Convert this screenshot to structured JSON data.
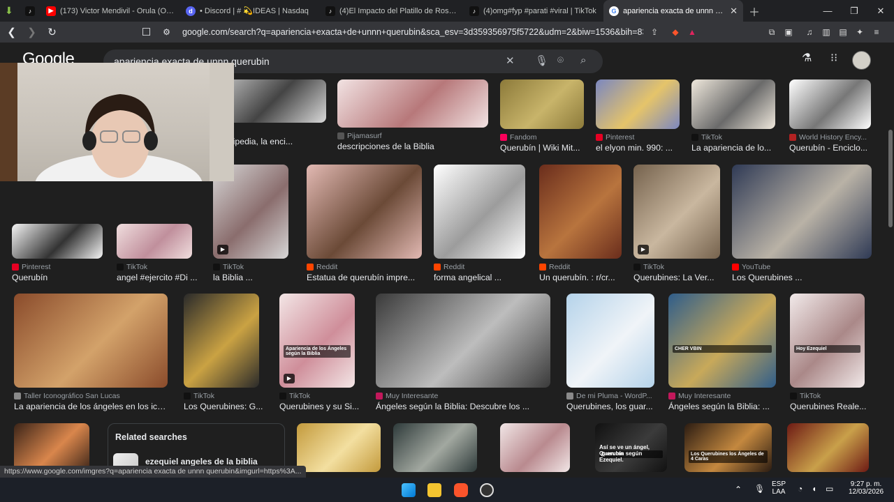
{
  "browser": {
    "tabs": [
      {
        "title": "(173) Victor Mendivil - Orula (Oficial)",
        "icon": "youtube-icon",
        "color": "#ff0000"
      },
      {
        "title": "• Discord | # 💫IDEAS | Nasdaq",
        "icon": "discord-icon",
        "color": "#5865f2"
      },
      {
        "title": "(4)El Impacto del Platillo de Roswell e",
        "icon": "tiktok-icon",
        "color": "#111111"
      },
      {
        "title": "(4)omg#fyp #parati #viral | TikTok",
        "icon": "tiktok-icon",
        "color": "#111111"
      },
      {
        "title": "apariencia exacta de unnn querubin",
        "icon": "google-icon",
        "color": "#4285f4",
        "active": true
      }
    ],
    "url": "google.com/search?q=apariencia+exacta+de+unnn+querubin&sca_esv=3d359356975f5722&udm=2&biw=1536&bih=831&s..."
  },
  "google": {
    "logo": "Google",
    "query": "apariencia exacta de unnn querubin"
  },
  "results": [
    {
      "id": "r0a",
      "source": "",
      "title": "",
      "colors": [
        "#e8d7d5",
        "#b88a86"
      ]
    },
    {
      "id": "r0b",
      "source": "",
      "title": "",
      "colors": [
        "#efe2e2",
        "#c49a9a"
      ]
    },
    {
      "id": "r0c",
      "source": "pedia",
      "title": "ín - Wikipedia, la enci...",
      "colors": [
        "#d9d9d9",
        "#444444"
      ]
    },
    {
      "id": "r0d",
      "source": "Pijamasurf",
      "title": "descripciones de la Biblia",
      "colors": [
        "#f2e3e3",
        "#b7787a"
      ]
    },
    {
      "id": "r0e",
      "source": "Fandom",
      "title": "Querubín | Wiki Mit...",
      "colors": [
        "#8c7a3a",
        "#c8b46a"
      ]
    },
    {
      "id": "r0f",
      "source": "Pinterest",
      "title": "el elyon min. 990: ...",
      "colors": [
        "#7b87c0",
        "#e5c46a"
      ]
    },
    {
      "id": "r0g",
      "source": "TikTok",
      "title": "La apariencia de lo...",
      "colors": [
        "#efe8dc",
        "#6a6a6a"
      ]
    },
    {
      "id": "r0h",
      "source": "World History Ency...",
      "title": "Querubín - Enciclo...",
      "colors": [
        "#ffffff",
        "#777777"
      ]
    },
    {
      "id": "r1a",
      "source": "Pinterest",
      "title": "Querubín",
      "colors": [
        "#f5f5f5",
        "#333333"
      ]
    },
    {
      "id": "r1b",
      "source": "TikTok",
      "title": "angel #ejercito #Di ...",
      "colors": [
        "#f0dede",
        "#c08f9c"
      ]
    },
    {
      "id": "r1c",
      "source": "TikTok",
      "title": "la Biblia ...",
      "colors": [
        "#d7d7d7",
        "#8a6d6d"
      ]
    },
    {
      "id": "r1d",
      "source": "Reddit",
      "title": "Estatua de querubín impre...",
      "colors": [
        "#e2b9b3",
        "#6b4a37"
      ]
    },
    {
      "id": "r1e",
      "source": "Reddit",
      "title": "forma angelical ...",
      "colors": [
        "#ffffff",
        "#9c9c9c"
      ]
    },
    {
      "id": "r1f",
      "source": "Reddit",
      "title": "Un querubín. : r/cr...",
      "colors": [
        "#6a2d1c",
        "#b8743e"
      ]
    },
    {
      "id": "r1g",
      "source": "TikTok",
      "title": "Querubines: La Ver...",
      "colors": [
        "#75624d",
        "#c9b79f"
      ]
    },
    {
      "id": "r1h",
      "source": "YouTube",
      "title": "Los Querubines ...",
      "colors": [
        "#2f3a55",
        "#b9b2a6"
      ]
    },
    {
      "id": "r2a",
      "source": "Taller Iconográfico San Lucas",
      "title": "La apariencia de los ángeles en los ico...",
      "colors": [
        "#8a4b2b",
        "#d3a26a"
      ]
    },
    {
      "id": "r2b",
      "source": "TikTok",
      "title": "Los Querubines: G...",
      "colors": [
        "#2a2a2a",
        "#caa243"
      ]
    },
    {
      "id": "r2c",
      "source": "TikTok",
      "title": "Querubines y su Si...",
      "colors": [
        "#f3e6e6",
        "#cf8e9a"
      ],
      "caption": "Apariencia de los Ángeles según la Biblia"
    },
    {
      "id": "r2d",
      "source": "Muy Interesante",
      "title": "Ángeles según la Biblia: Descubre los ...",
      "colors": [
        "#3a3a3a",
        "#bdbdbd"
      ]
    },
    {
      "id": "r2e",
      "source": "De mi Pluma - WordP...",
      "title": "Querubines, los guar...",
      "colors": [
        "#b5d3ea",
        "#f0f4f8"
      ]
    },
    {
      "id": "r2f",
      "source": "Muy Interesante",
      "title": "Ángeles según la Biblia: ...",
      "colors": [
        "#2f5d8a",
        "#c8a95a"
      ],
      "caption": "CHER VBIN"
    },
    {
      "id": "r2g",
      "source": "TikTok",
      "title": "Querubines Reale...",
      "colors": [
        "#f2eaea",
        "#a88"
      ],
      "caption": "Hoy Ezequiel"
    },
    {
      "id": "r3a",
      "source": "",
      "title": "",
      "colors": [
        "#3b2418",
        "#d9864c"
      ]
    },
    {
      "id": "r3b",
      "source": "",
      "title": "",
      "colors": [
        "#c39a3c",
        "#f3dfa0"
      ]
    },
    {
      "id": "r3c",
      "source": "",
      "title": "",
      "colors": [
        "#2e3a3a",
        "#a2a8a0"
      ]
    },
    {
      "id": "r3d",
      "source": "",
      "title": "",
      "colors": [
        "#f1e6e6",
        "#b98a8f"
      ]
    },
    {
      "id": "r3e",
      "source": "",
      "title": "",
      "colors": [
        "#111111",
        "#3b3b3b"
      ],
      "caption": "Querubín",
      "caption2": "Así se ve un ángel, Querubín según Ezequiel."
    },
    {
      "id": "r3f",
      "source": "",
      "title": "",
      "colors": [
        "#2b1c12",
        "#c4883f"
      ],
      "caption": "Los Querubines los Ángeles de 4 Caras"
    },
    {
      "id": "r3g",
      "source": "",
      "title": "",
      "colors": [
        "#6d1a14",
        "#c9a04a"
      ]
    }
  ],
  "related": {
    "title": "Related searches",
    "item": "ezequiel angeles de la biblia"
  },
  "status_url": "https://www.google.com/imgres?q=apariencia exacta de unnn querubin&imgurl=https%3A...",
  "taskbar": {
    "lang_top": "ESP",
    "lang_bottom": "LAA",
    "time": "9:27 p. m.",
    "date": "12/03/2026"
  }
}
